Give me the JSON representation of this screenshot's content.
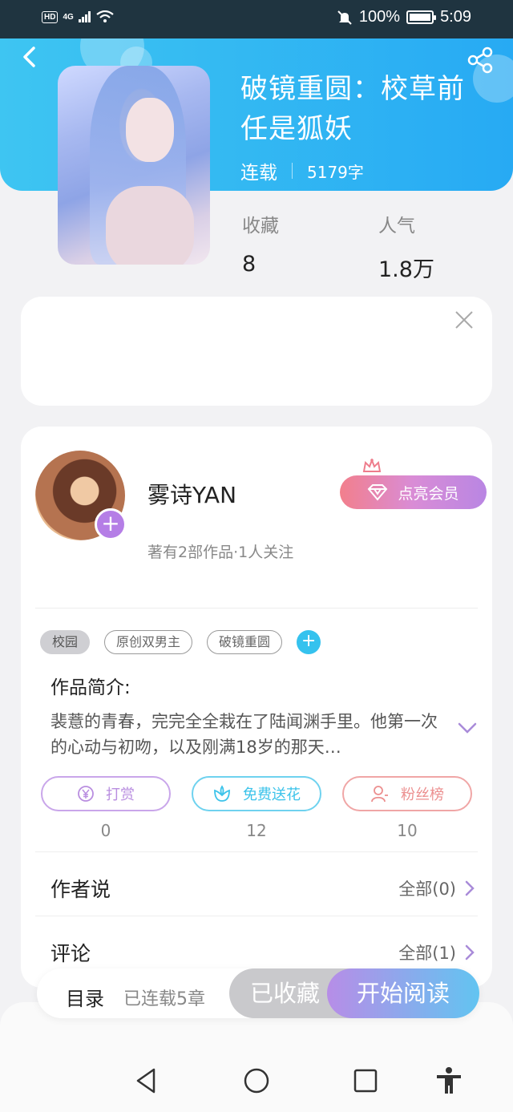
{
  "status_bar": {
    "network": "4G",
    "battery": "100%",
    "time": "5:09",
    "hd": "HD"
  },
  "book": {
    "title": "破镜重圆：校草前任是狐妖",
    "status": "连载",
    "word_count": "5179字"
  },
  "stats": [
    {
      "label": "收藏",
      "value": "8"
    },
    {
      "label": "人气",
      "value": "1.8万"
    }
  ],
  "author": {
    "name": "雾诗YAN",
    "subtitle": "著有2部作品·1人关注",
    "vip_label": "点亮会员"
  },
  "tags": [
    "校园",
    "原创双男主",
    "破镜重圆"
  ],
  "intro": {
    "heading": "作品简介:",
    "text": "裴薏的青春，完完全全栽在了陆闻渊手里。他第一次的心动与初吻，以及刚满18岁的那天…"
  },
  "actions": [
    {
      "label": "打赏",
      "count": "0",
      "color": "#b98ee0"
    },
    {
      "label": "免费送花",
      "count": "12",
      "color": "#3cc3ea"
    },
    {
      "label": "粉丝榜",
      "count": "10",
      "color": "#ec8f8f"
    }
  ],
  "rows": [
    {
      "title": "作者说",
      "right": "全部(0)"
    },
    {
      "title": "评论",
      "right": "全部(1)"
    }
  ],
  "bottom": {
    "toc": "目录",
    "toc_sub": "已连载5章",
    "collected": "已收藏",
    "read": "开始阅读"
  },
  "colors": {
    "header": "#30b6f2",
    "accent_purple": "#b57ee6"
  }
}
